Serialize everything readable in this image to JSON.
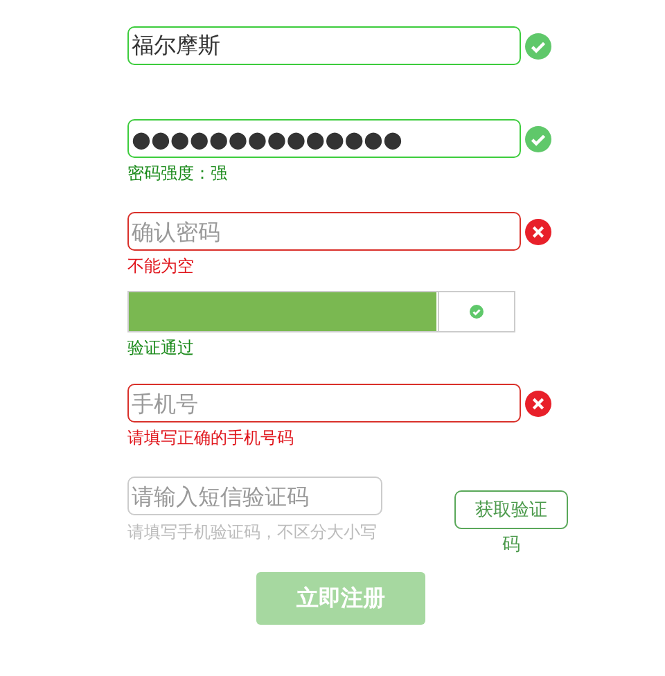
{
  "fields": [
    {
      "kind": "text",
      "value": "福尔摩斯",
      "valid": true
    },
    {
      "kind": "text",
      "value": "●●●●●●●●●●●●●●",
      "valid": true,
      "message": "密码强度：强"
    },
    {
      "kind": "text",
      "placeholder": "确认密码",
      "valid": false,
      "message": "不能为空"
    },
    {
      "kind": "slider",
      "level": 0.8,
      "valid": true,
      "message": "验证通过"
    },
    {
      "kind": "text",
      "placeholder": "手机号",
      "valid": false,
      "message": "请填写正确的手机号码"
    },
    {
      "kind": "sms",
      "placeholder": "请输入短信验证码",
      "hint": "请填写手机验证码，不区分大小写",
      "button": "获取验证码"
    }
  ],
  "submit": {
    "label": "立即注册",
    "disabled": true
  }
}
